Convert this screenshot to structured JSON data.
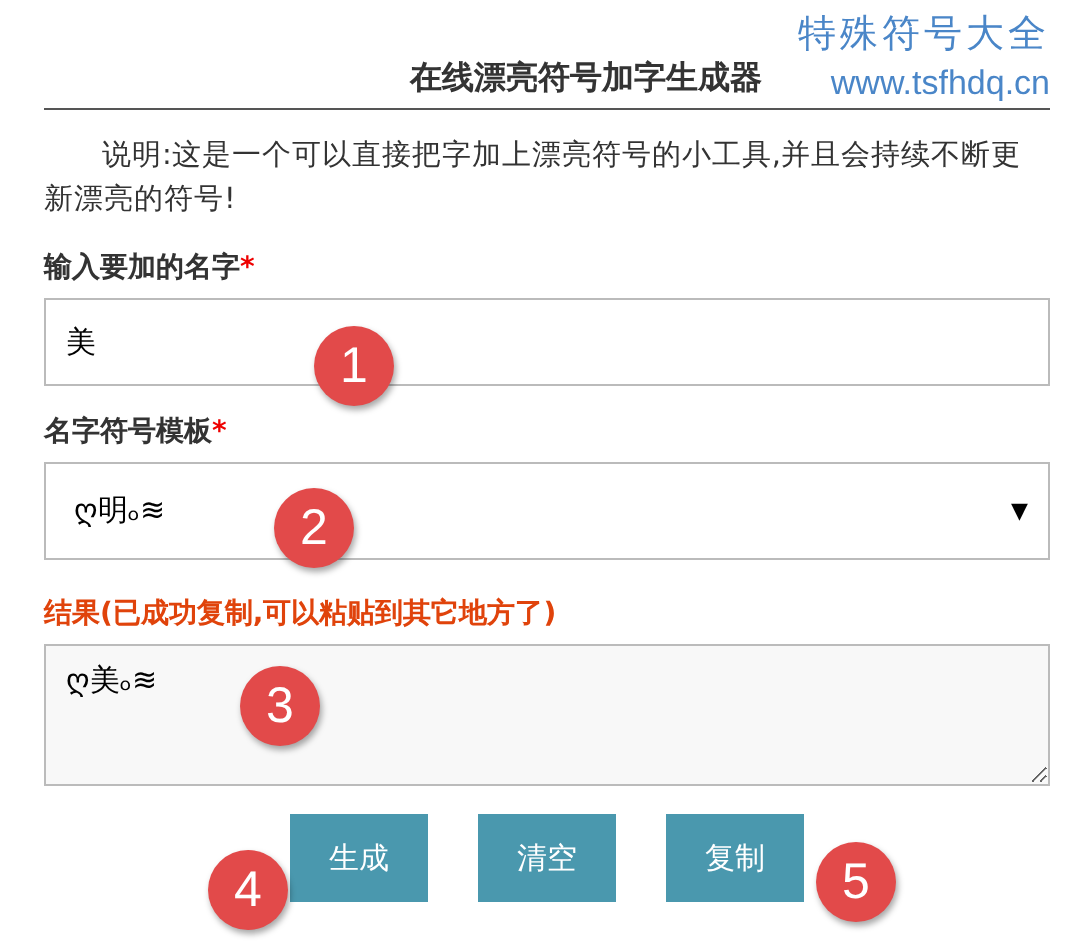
{
  "site": {
    "name": "特殊符号大全",
    "url": "www.tsfhdq.cn"
  },
  "title": "在线漂亮符号加字生成器",
  "intro": "说明:这是一个可以直接把字加上漂亮符号的小工具,并且会持续不断更新漂亮的符号!",
  "name_field": {
    "label": "输入要加的名字",
    "required_mark": "*",
    "value": "美"
  },
  "template_select": {
    "label": "名字符号模板",
    "required_mark": "*",
    "value": "ღ明ₒ≋",
    "arrow": "▼"
  },
  "result": {
    "label": "结果(已成功复制,可以粘贴到其它地方了)",
    "value": "ღ美ₒ≋"
  },
  "buttons": [
    {
      "label": "生成"
    },
    {
      "label": "清空"
    },
    {
      "label": "复制"
    }
  ],
  "callouts": [
    {
      "number": "1"
    },
    {
      "number": "2"
    },
    {
      "number": "3"
    },
    {
      "number": "4"
    },
    {
      "number": "5"
    }
  ]
}
